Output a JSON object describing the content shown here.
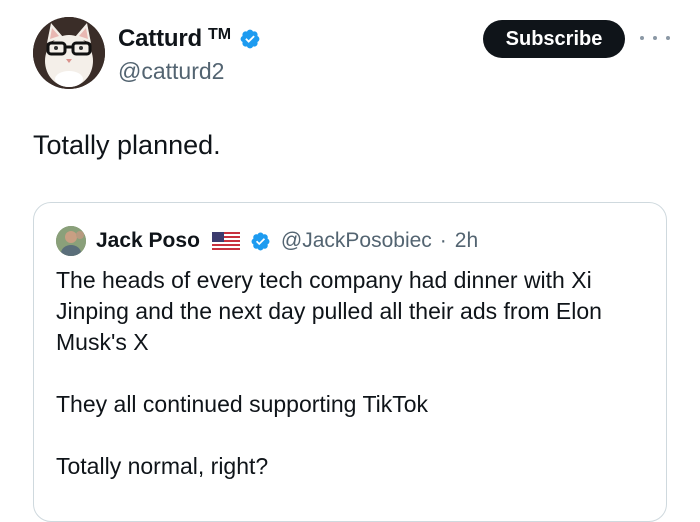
{
  "author": {
    "display_name": "Catturd",
    "trademark": "TM",
    "handle": "@catturd2",
    "verified_icon": "verified-badge-icon"
  },
  "actions": {
    "subscribe_label": "Subscribe",
    "more_icon": "more-options-icon"
  },
  "tweet": {
    "text": "Totally planned."
  },
  "quoted": {
    "display_name": "Jack Poso",
    "flag_icon": "us-flag-icon",
    "verified_icon": "verified-badge-icon",
    "handle": "@JackPosobiec",
    "separator": "·",
    "time": "2h",
    "paragraphs": [
      "The heads of every tech company had dinner with Xi Jinping and the next day pulled all their ads from Elon Musk's X",
      "They all continued supporting TikTok",
      "Totally normal, right?"
    ]
  },
  "colors": {
    "text": "#0f1419",
    "secondary": "#536471",
    "verified_blue": "#1d9bf0",
    "button_bg": "#0f1419",
    "border": "#cfd9de"
  }
}
